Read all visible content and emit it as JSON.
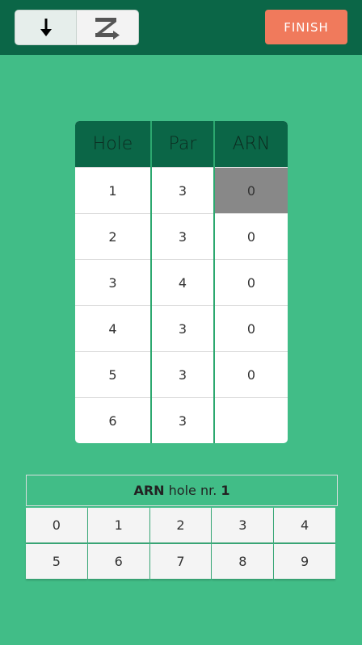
{
  "toolbar": {
    "sort_down_icon": "arrow-down-icon",
    "switch_icon": "swap-icon",
    "finish_label": "FINISH"
  },
  "table": {
    "headers": [
      "Hole",
      "Par",
      "ARN"
    ],
    "rows": [
      {
        "hole": "1",
        "par": "3",
        "arn": "0"
      },
      {
        "hole": "2",
        "par": "3",
        "arn": "0"
      },
      {
        "hole": "3",
        "par": "4",
        "arn": "0"
      },
      {
        "hole": "4",
        "par": "3",
        "arn": "0"
      },
      {
        "hole": "5",
        "par": "3",
        "arn": "0"
      },
      {
        "hole": "6",
        "par": "3",
        "arn": ""
      }
    ]
  },
  "prompt": {
    "player": "ARN",
    "text": "hole nr.",
    "hole": "1"
  },
  "keypad": {
    "keys": [
      "0",
      "1",
      "2",
      "3",
      "4",
      "5",
      "6",
      "7",
      "8",
      "9"
    ]
  },
  "colors": {
    "background": "#41bd87",
    "header": "#0b6647",
    "accent": "#f07a5c",
    "selected_cell": "#888888"
  }
}
